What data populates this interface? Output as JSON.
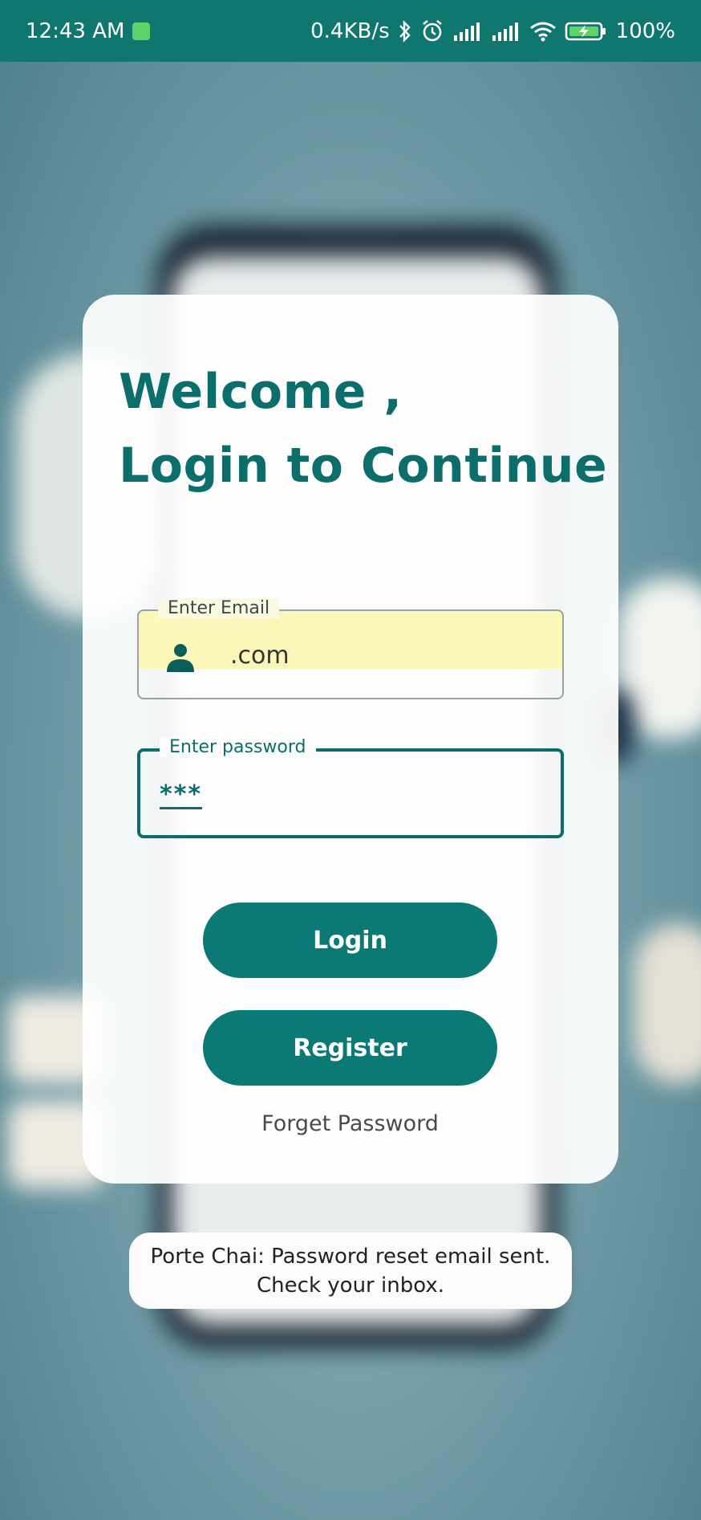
{
  "status_bar": {
    "time": "12:43 AM",
    "network_speed": "0.4KB/s",
    "battery": "100%",
    "icons": [
      "android-notification-icon",
      "bluetooth-icon",
      "alarm-icon",
      "signal-icon",
      "signal-icon",
      "wifi-icon",
      "battery-charging-icon"
    ]
  },
  "login": {
    "title_line1": "Welcome ,",
    "title_line2": "Login to Continue",
    "email_label": "Enter Email",
    "email_value": ".com",
    "password_label": "Enter password",
    "password_value": "***",
    "login_button": "Login",
    "register_button": "Register",
    "forgot_link": "Forget Password"
  },
  "toast": {
    "message": "Porte Chai: Password reset email sent. Check your inbox."
  },
  "colors": {
    "accent": "#0c7a74",
    "status_bar": "#0f7670",
    "autofill": "#fbf7b8"
  }
}
